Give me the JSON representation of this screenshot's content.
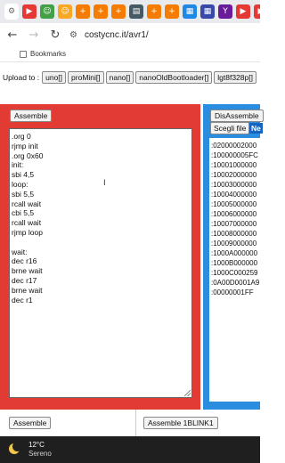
{
  "browser": {
    "tabs": [
      {
        "icon": "gear-icon",
        "color": "#666666",
        "glyph": "⚙"
      },
      {
        "icon": "youtube-icon",
        "color": "#e53935",
        "glyph": "▶"
      },
      {
        "icon": "emoji-icon",
        "color": "#43a047",
        "glyph": "☺"
      },
      {
        "icon": "emoji-icon",
        "color": "#f9a825",
        "glyph": "☺"
      },
      {
        "icon": "plus-icon",
        "color": "#f57c00",
        "glyph": "+"
      },
      {
        "icon": "plus-icon",
        "color": "#f57c00",
        "glyph": "+"
      },
      {
        "icon": "plus-icon",
        "color": "#f57c00",
        "glyph": "+"
      },
      {
        "icon": "image-icon",
        "color": "#455a64",
        "glyph": "▤"
      },
      {
        "icon": "plus-icon",
        "color": "#f57c00",
        "glyph": "+"
      },
      {
        "icon": "plus-icon",
        "color": "#f57c00",
        "glyph": "+"
      },
      {
        "icon": "grid-icon",
        "color": "#1e88e5",
        "glyph": "▦"
      },
      {
        "icon": "grid-icon",
        "color": "#3949ab",
        "glyph": "▦"
      },
      {
        "icon": "yahoo-icon",
        "color": "#6a1b9a",
        "glyph": "Y"
      },
      {
        "icon": "youtube-icon",
        "color": "#e53935",
        "glyph": "▶"
      },
      {
        "icon": "youtube-icon",
        "color": "#e53935",
        "glyph": "▶"
      },
      {
        "icon": "youtube-icon",
        "color": "#e53935",
        "glyph": "▶"
      }
    ],
    "active_tab_color": "#ffffff",
    "url": "costycnc.it/avr1/",
    "bookmarks_label": "Bookmarks"
  },
  "upload": {
    "label": "Upload to :",
    "buttons": [
      "uno[]",
      "proMini[]",
      "nano[]",
      "nanoOldBootloader[]",
      "lgt8f328p[]"
    ]
  },
  "assembler": {
    "assemble_label": "Assemble",
    "code_lines": [
      ".org 0",
      "rjmp init",
      ".org 0x60",
      "init:",
      "sbi 4,5",
      "loop:",
      "sbi 5,5",
      "rcall wait",
      "cbi 5,5",
      "rcall wait",
      "rjmp loop",
      "",
      "wait:",
      "dec r16",
      "brne wait",
      "dec r17",
      "brne wait",
      "dec r1"
    ]
  },
  "disassembler": {
    "disassemble_label": "DisAssemble",
    "file_button_label": "Scegli file",
    "file_chip_label": "Ne",
    "hex_lines": [
      ":02000002000",
      ":100000005FC",
      ":10001000000",
      ":10002000000",
      ":10003000000",
      ":10004000000",
      ":10005000000",
      ":10006000000",
      ":10007000000",
      ":10008000000",
      ":10009000000",
      ":1000A000000",
      ":1000B000000",
      ":1000C000259",
      ":0A00D0001A9",
      ":00000001FF"
    ]
  },
  "bottom": {
    "assemble_label": "Assemble",
    "assemble_blink_label": "Assemble 1BLINK1"
  },
  "taskbar": {
    "temperature": "12°C",
    "condition": "Sereno"
  },
  "colors": {
    "red_panel": "#e23b34",
    "blue_panel": "#2b8de0",
    "taskbar": "#1f1f1f"
  }
}
